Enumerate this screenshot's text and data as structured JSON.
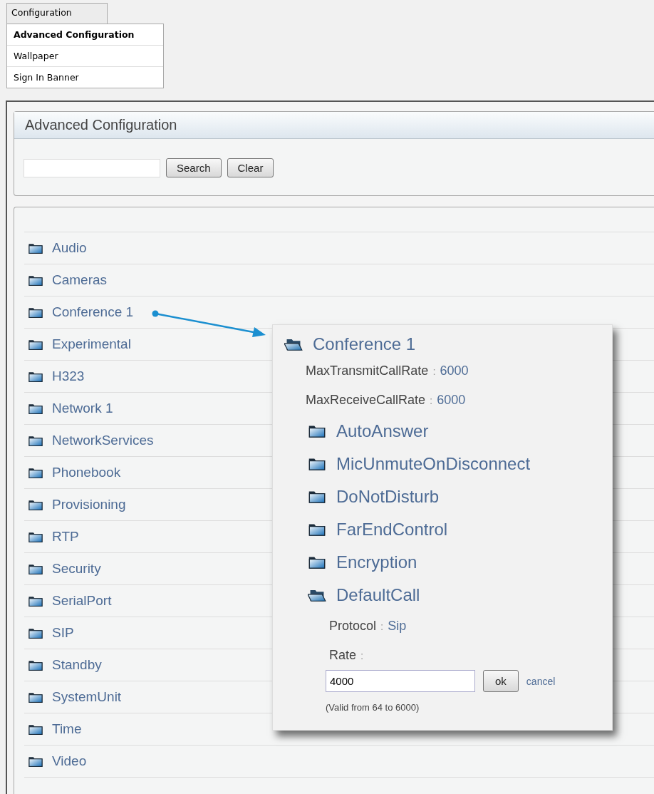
{
  "menu": {
    "tab": "Configuration",
    "items": [
      {
        "label": "Advanced Configuration",
        "selected": true
      },
      {
        "label": "Wallpaper",
        "selected": false
      },
      {
        "label": "Sign In Banner",
        "selected": false
      }
    ]
  },
  "panel": {
    "title": "Advanced Configuration",
    "buttons": [
      "Search",
      "Clear"
    ]
  },
  "tree": {
    "items": [
      {
        "label": "Audio",
        "expanded": false
      },
      {
        "label": "Cameras",
        "expanded": false
      },
      {
        "label": "Conference 1",
        "expanded": false
      },
      {
        "label": "Experimental",
        "expanded": false
      },
      {
        "label": "H323",
        "expanded": false
      },
      {
        "label": "Network 1",
        "expanded": false
      },
      {
        "label": "NetworkServices",
        "expanded": false
      },
      {
        "label": "Phonebook",
        "expanded": false
      },
      {
        "label": "Provisioning",
        "expanded": false
      },
      {
        "label": "RTP",
        "expanded": false
      },
      {
        "label": "Security",
        "expanded": false
      },
      {
        "label": "SerialPort",
        "expanded": false
      },
      {
        "label": "SIP",
        "expanded": false
      },
      {
        "label": "Standby",
        "expanded": false
      },
      {
        "label": "SystemUnit",
        "expanded": false
      },
      {
        "label": "Time",
        "expanded": false
      },
      {
        "label": "Video",
        "expanded": false
      }
    ]
  },
  "popup": {
    "title": "Conference 1",
    "expanded": true,
    "params": [
      {
        "label": "MaxTransmitCallRate",
        "separator": ":",
        "value": "6000"
      },
      {
        "label": "MaxReceiveCallRate",
        "separator": ":",
        "value": "6000"
      }
    ],
    "folders": [
      {
        "label": "AutoAnswer",
        "expanded": false
      },
      {
        "label": "MicUnmuteOnDisconnect",
        "expanded": false
      },
      {
        "label": "DoNotDisturb",
        "expanded": false
      },
      {
        "label": "FarEndControl",
        "expanded": false
      },
      {
        "label": "Encryption",
        "expanded": false
      },
      {
        "label": "DefaultCall",
        "expanded": true,
        "params": [
          {
            "label": "Protocol",
            "separator": ":",
            "value": "Sip"
          }
        ],
        "editor": {
          "label": "Rate",
          "separator": ":",
          "value": "4000",
          "ok": "ok",
          "cancel": "cancel",
          "hint": "(Valid from 64 to 6000)"
        }
      }
    ]
  }
}
